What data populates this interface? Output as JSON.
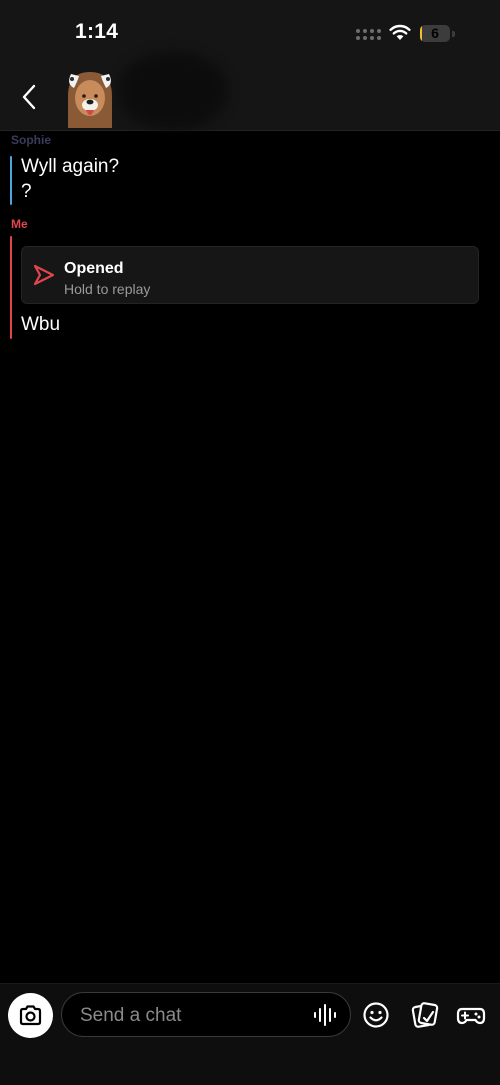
{
  "status_bar": {
    "time": "1:14",
    "battery_level": "6"
  },
  "header": {
    "avatar_icon": "bitmoji-avatar-icon",
    "back_icon": "chevron-left-icon"
  },
  "conversation": {
    "them": {
      "sender": "Sophie",
      "messages": [
        "Wyll again?",
        "?"
      ]
    },
    "me": {
      "sender": "Me",
      "snap": {
        "status": "Opened",
        "hint": "Hold to replay",
        "icon": "sent-arrow-icon",
        "color": "#e0464d"
      },
      "messages": [
        "Wbu"
      ]
    }
  },
  "composer": {
    "placeholder": "Send a chat",
    "value": "",
    "icons": [
      "camera-icon",
      "voice-icon",
      "emoji-icon",
      "sticker-icon",
      "games-icon"
    ]
  },
  "colors": {
    "me_accent": "#e0464d",
    "them_accent": "#4ea6df",
    "background": "#000000"
  }
}
